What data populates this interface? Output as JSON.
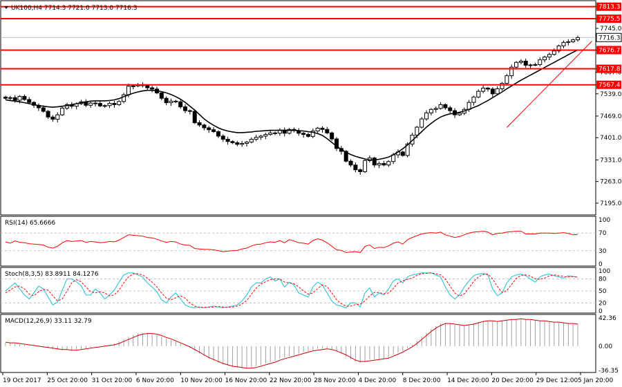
{
  "chart_data": [
    {
      "type": "candlestick",
      "title": "UK100,H4  7714.3 7721.0 7713.0 7716.3",
      "ylim": [
        7160,
        7830
      ],
      "ticks": [
        "7813.3",
        "7775.5",
        "7745.0",
        "7716.3",
        "7676.7",
        "7617.8",
        "7607.0",
        "7567.4",
        "7539.0",
        "7469.0",
        "7401.0",
        "7331.0",
        "7263.0",
        "7195.0"
      ],
      "tick_values": [
        7813.3,
        7775.5,
        7745.0,
        7716.3,
        7676.7,
        7617.8,
        7607.0,
        7567.4,
        7539.0,
        7469.0,
        7401.0,
        7331.0,
        7263.0,
        7195.0
      ],
      "levels": [
        7813.3,
        7775.5,
        7676.7,
        7617.8,
        7567.4
      ],
      "level_labels": [
        "7813.3",
        "7775.5",
        "7676.7",
        "7617.8",
        "7567.4"
      ],
      "current_price": "7716.3",
      "closes": [
        7525,
        7527,
        7519,
        7531,
        7521,
        7512,
        7503,
        7495,
        7484,
        7466,
        7459,
        7473,
        7494,
        7505,
        7500,
        7508,
        7514,
        7503,
        7510,
        7509,
        7501,
        7502,
        7509,
        7505,
        7515,
        7536,
        7563,
        7564,
        7567,
        7565,
        7558,
        7554,
        7542,
        7525,
        7511,
        7516,
        7514,
        7498,
        7486,
        7484,
        7448,
        7441,
        7432,
        7426,
        7420,
        7406,
        7396,
        7389,
        7385,
        7380,
        7383,
        7387,
        7396,
        7402,
        7406,
        7411,
        7416,
        7415,
        7425,
        7415,
        7427,
        7423,
        7415,
        7411,
        7405,
        7422,
        7431,
        7427,
        7416,
        7397,
        7367,
        7358,
        7327,
        7315,
        7300,
        7294,
        7329,
        7337,
        7315,
        7320,
        7315,
        7326,
        7347,
        7356,
        7345,
        7381,
        7409,
        7434,
        7460,
        7479,
        7490,
        7493,
        7505,
        7495,
        7486,
        7473,
        7478,
        7490,
        7512,
        7529,
        7547,
        7557,
        7554,
        7539,
        7555,
        7572,
        7596,
        7623,
        7638,
        7642,
        7629,
        7630,
        7631,
        7646,
        7655,
        7663,
        7674,
        7690,
        7701,
        7703,
        7709,
        7716
      ],
      "ma": [
        7520,
        7518,
        7516,
        7514,
        7511,
        7508,
        7505,
        7502,
        7500,
        7498,
        7497,
        7498,
        7500,
        7502,
        7505,
        7508,
        7511,
        7514,
        7516,
        7517,
        7517,
        7517,
        7518,
        7520,
        7524,
        7530,
        7536,
        7541,
        7545,
        7548,
        7550,
        7550,
        7549,
        7546,
        7542,
        7537,
        7530,
        7522,
        7512,
        7500,
        7488,
        7474,
        7460,
        7449,
        7440,
        7432,
        7426,
        7422,
        7419,
        7417,
        7417,
        7418,
        7419,
        7421,
        7422,
        7423,
        7424,
        7424,
        7424,
        7424,
        7424,
        7424,
        7423,
        7422,
        7420,
        7418,
        7414,
        7408,
        7398,
        7386,
        7374,
        7364,
        7355,
        7348,
        7342,
        7338,
        7334,
        7331,
        7331,
        7333,
        7336,
        7340,
        7347,
        7356,
        7366,
        7378,
        7392,
        7406,
        7420,
        7434,
        7446,
        7457,
        7466,
        7472,
        7476,
        7478,
        7481,
        7485,
        7490,
        7496,
        7502,
        7510,
        7518,
        7527,
        7536,
        7545,
        7555,
        7564,
        7573,
        7582,
        7590,
        7598,
        7606,
        7614,
        7622,
        7630,
        7638,
        7646,
        7654,
        7662,
        7670,
        7677
      ],
      "trendline": {
        "from": [
          7433
        ],
        "to": [
          7705
        ]
      },
      "x_labels": [
        "19 Oct 2017",
        "25 Oct 20:00",
        "31 Oct 20:00",
        "6 Nov 20:00",
        "10 Nov 20:00",
        "16 Nov 20:00",
        "22 Nov 20:00",
        "28 Nov 20:00",
        "4 Dec 20:00",
        "8 Dec 20:00",
        "14 Dec 20:00",
        "20 Dec 20:00",
        "29 Dec 12:00",
        "5 Jan 20:00"
      ],
      "colors": {
        "bull": "#ffffff",
        "bear": "#000000",
        "ma": "#000000",
        "level": "#ff0000",
        "trend": "#ff0000"
      }
    },
    {
      "type": "line",
      "title": "RSI(14) 65.6666",
      "ylim": [
        0,
        100
      ],
      "ticks": [
        "100",
        "70",
        "30",
        "0"
      ],
      "tick_values": [
        100,
        70,
        30,
        0
      ],
      "guides": [
        70,
        30
      ],
      "values": [
        50,
        47,
        52,
        49,
        48,
        46,
        45,
        44,
        43,
        38,
        36,
        40,
        48,
        53,
        51,
        52,
        53,
        49,
        51,
        50,
        48,
        49,
        51,
        50,
        54,
        60,
        66,
        65,
        64,
        63,
        60,
        59,
        56,
        52,
        49,
        51,
        50,
        45,
        43,
        42,
        35,
        34,
        33,
        33,
        32,
        30,
        28,
        29,
        30,
        31,
        34,
        36,
        41,
        44,
        45,
        48,
        50,
        49,
        53,
        48,
        55,
        52,
        48,
        47,
        45,
        53,
        57,
        54,
        48,
        40,
        32,
        31,
        26,
        27,
        28,
        26,
        40,
        43,
        35,
        38,
        37,
        41,
        47,
        50,
        45,
        55,
        60,
        64,
        68,
        70,
        71,
        70,
        72,
        66,
        63,
        60,
        62,
        66,
        70,
        72,
        73,
        74,
        72,
        66,
        69,
        70,
        72,
        73,
        74,
        74,
        68,
        68,
        68,
        70,
        70,
        70,
        69,
        70,
        71,
        69,
        66,
        67
      ],
      "color": "#ff0000"
    },
    {
      "type": "line",
      "title": "Stoch(8,3,5) 83.8911 84.1276",
      "ylim": [
        0,
        100
      ],
      "ticks": [
        "100",
        "80",
        "50",
        "20",
        "0"
      ],
      "tick_values": [
        100,
        80,
        50,
        20,
        0
      ],
      "guides": [
        80,
        50,
        20
      ],
      "k": [
        50,
        60,
        70,
        55,
        40,
        30,
        45,
        62,
        55,
        35,
        15,
        22,
        52,
        80,
        80,
        73,
        63,
        40,
        40,
        55,
        45,
        30,
        40,
        52,
        72,
        90,
        95,
        95,
        90,
        85,
        70,
        60,
        48,
        28,
        20,
        35,
        45,
        30,
        15,
        10,
        8,
        10,
        8,
        10,
        12,
        10,
        8,
        10,
        12,
        15,
        25,
        40,
        60,
        70,
        70,
        80,
        85,
        75,
        80,
        60,
        72,
        65,
        45,
        40,
        35,
        60,
        72,
        65,
        45,
        25,
        15,
        12,
        8,
        20,
        20,
        10,
        45,
        58,
        35,
        45,
        40,
        55,
        75,
        80,
        70,
        85,
        90,
        92,
        95,
        95,
        95,
        90,
        85,
        60,
        40,
        30,
        40,
        60,
        75,
        88,
        92,
        94,
        90,
        55,
        38,
        45,
        70,
        85,
        90,
        92,
        88,
        80,
        72,
        85,
        90,
        92,
        88,
        85,
        82,
        88,
        86,
        84
      ],
      "d": [
        45,
        52,
        60,
        62,
        55,
        42,
        38,
        48,
        54,
        52,
        38,
        25,
        30,
        50,
        70,
        78,
        73,
        60,
        48,
        45,
        48,
        45,
        38,
        40,
        52,
        70,
        85,
        93,
        93,
        90,
        82,
        72,
        60,
        45,
        32,
        28,
        33,
        38,
        32,
        20,
        12,
        9,
        9,
        9,
        10,
        11,
        10,
        9,
        10,
        12,
        17,
        26,
        42,
        57,
        67,
        73,
        78,
        80,
        80,
        72,
        70,
        68,
        60,
        50,
        42,
        45,
        56,
        65,
        61,
        45,
        28,
        18,
        12,
        12,
        16,
        17,
        25,
        38,
        46,
        46,
        43,
        45,
        56,
        70,
        75,
        79,
        82,
        89,
        93,
        94,
        95,
        93,
        90,
        80,
        62,
        45,
        37,
        43,
        58,
        74,
        85,
        91,
        92,
        80,
        61,
        46,
        51,
        66,
        81,
        89,
        90,
        87,
        80,
        79,
        82,
        88,
        90,
        88,
        86,
        85,
        86,
        85
      ]
    },
    {
      "type": "bar+line",
      "title": "MACD(12,26,9) 33.11 32.79",
      "ylim": [
        -36.35,
        42.36
      ],
      "ticks": [
        "42.36",
        "0.00",
        "-36.35"
      ],
      "tick_values": [
        42.36,
        0,
        -36.35
      ],
      "histogram": [
        5,
        5,
        4,
        3,
        2,
        1,
        0,
        -1,
        -2,
        -3,
        -5,
        -6,
        -6,
        -6,
        -6,
        -5,
        -4,
        -3,
        -2,
        -1,
        0,
        1,
        2,
        4,
        7,
        10,
        14,
        17,
        19,
        20,
        20,
        19,
        17,
        14,
        11,
        9,
        7,
        4,
        1,
        -3,
        -7,
        -11,
        -15,
        -19,
        -22,
        -25,
        -27,
        -29,
        -31,
        -32,
        -33,
        -33,
        -32,
        -30,
        -28,
        -26,
        -24,
        -22,
        -19,
        -17,
        -15,
        -13,
        -11,
        -9,
        -8,
        -6,
        -4,
        -3,
        -3,
        -5,
        -8,
        -12,
        -16,
        -20,
        -23,
        -25,
        -23,
        -20,
        -20,
        -19,
        -19,
        -17,
        -13,
        -10,
        -8,
        -3,
        2,
        8,
        14,
        20,
        26,
        30,
        34,
        35,
        34,
        32,
        31,
        31,
        32,
        34,
        36,
        38,
        38,
        37,
        37,
        38,
        39,
        40,
        41,
        41,
        40,
        39,
        38,
        38,
        37,
        36,
        36,
        35,
        35,
        34,
        33,
        33
      ],
      "signal": [
        6,
        5,
        5,
        4,
        3,
        2,
        1,
        0,
        -1,
        -2,
        -3,
        -4,
        -5,
        -5,
        -6,
        -6,
        -5,
        -4,
        -3,
        -2,
        -1,
        0,
        1,
        2,
        4,
        7,
        10,
        13,
        16,
        18,
        19,
        19,
        18,
        16,
        13,
        11,
        8,
        5,
        2,
        -1,
        -5,
        -9,
        -13,
        -17,
        -20,
        -23,
        -26,
        -28,
        -30,
        -31,
        -32,
        -33,
        -33,
        -32,
        -30,
        -28,
        -26,
        -24,
        -21,
        -19,
        -17,
        -15,
        -13,
        -11,
        -9,
        -7,
        -6,
        -5,
        -4,
        -5,
        -7,
        -10,
        -13,
        -17,
        -21,
        -23,
        -23,
        -22,
        -21,
        -20,
        -19,
        -18,
        -15,
        -12,
        -9,
        -5,
        -1,
        4,
        10,
        16,
        22,
        27,
        31,
        34,
        34,
        33,
        32,
        31,
        32,
        33,
        35,
        37,
        38,
        38,
        37,
        38,
        39,
        40,
        40,
        41,
        40,
        40,
        39,
        38,
        38,
        37,
        36,
        36,
        35,
        34,
        34,
        33
      ]
    }
  ]
}
